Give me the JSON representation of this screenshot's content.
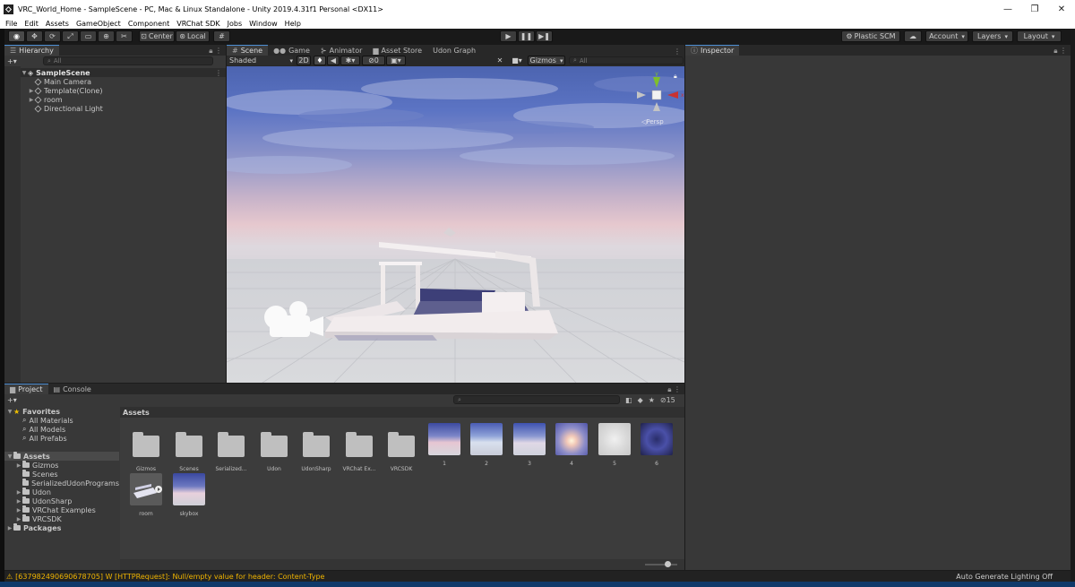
{
  "window": {
    "title": "VRC_World_Home - SampleScene - PC, Mac & Linux Standalone - Unity 2019.4.31f1 Personal <DX11>",
    "controls": [
      "—",
      "❐",
      "✕"
    ]
  },
  "menubar": [
    "File",
    "Edit",
    "Assets",
    "GameObject",
    "Component",
    "VRChat SDK",
    "Jobs",
    "Window",
    "Help"
  ],
  "toolbar": {
    "tools": [
      "hand-icon",
      "move-icon",
      "rotate-icon",
      "scale-icon",
      "rect-icon",
      "transform-icon",
      "custom-tool-icon"
    ],
    "pivot_label": "Center",
    "space_label": "Local",
    "play_controls": [
      "▶",
      "❚❚",
      "▶❚"
    ],
    "plastic_label": "Plastic SCM",
    "account_label": "Account",
    "layers_label": "Layers",
    "layout_label": "Layout"
  },
  "hierarchy": {
    "tab_label": "Hierarchy",
    "add_label": "+▾",
    "search_placeholder": "All",
    "scene_name": "SampleScene",
    "items": [
      {
        "label": "Main Camera",
        "expandable": false
      },
      {
        "label": "Template(Clone)",
        "expandable": true
      },
      {
        "label": "room",
        "expandable": true
      },
      {
        "label": "Directional Light",
        "expandable": false
      }
    ]
  },
  "scene": {
    "tabs": [
      "Scene",
      "Game",
      "Animator",
      "Asset Store",
      "Udon Graph"
    ],
    "shading": "Shaded",
    "mode_2d": "2D",
    "hidden_count": "0",
    "gizmos_label": "Gizmos",
    "search_placeholder": "All",
    "persp_label": "Persp"
  },
  "inspector": {
    "tab_label": "Inspector"
  },
  "project": {
    "tabs": [
      "Project",
      "Console"
    ],
    "add_label": "+▾",
    "hidden_count": "15",
    "breadcrumb": "Assets",
    "favorites_label": "Favorites",
    "favorites": [
      "All Materials",
      "All Models",
      "All Prefabs"
    ],
    "assets_label": "Assets",
    "asset_folders": [
      "Gizmos",
      "Scenes",
      "SerializedUdonPrograms",
      "Udon",
      "UdonSharp",
      "VRChat Examples",
      "VRCSDK"
    ],
    "packages_label": "Packages",
    "grid_items": [
      {
        "label": "Gizmos",
        "kind": "folder"
      },
      {
        "label": "Scenes",
        "kind": "folder"
      },
      {
        "label": "Serialized...",
        "kind": "folder"
      },
      {
        "label": "Udon",
        "kind": "folder"
      },
      {
        "label": "UdonSharp",
        "kind": "folder"
      },
      {
        "label": "VRChat Ex...",
        "kind": "folder"
      },
      {
        "label": "VRCSDK",
        "kind": "folder"
      },
      {
        "label": "1",
        "kind": "sky1"
      },
      {
        "label": "2",
        "kind": "sky2"
      },
      {
        "label": "3",
        "kind": "sky3"
      },
      {
        "label": "4",
        "kind": "sky4"
      },
      {
        "label": "5",
        "kind": "sky5"
      },
      {
        "label": "6",
        "kind": "sky6"
      },
      {
        "label": "room",
        "kind": "model"
      },
      {
        "label": "skybox",
        "kind": "skybox"
      }
    ],
    "zoom_slider": 0.7
  },
  "status": {
    "message": "[637982490690678705] W [HTTPRequest]: Null/empty value for header: Content-Type",
    "right_label": "Auto Generate Lighting Off"
  },
  "colors": {
    "accent": "#4d8ed4",
    "warning": "#f0b400",
    "star": "#f0c000"
  }
}
